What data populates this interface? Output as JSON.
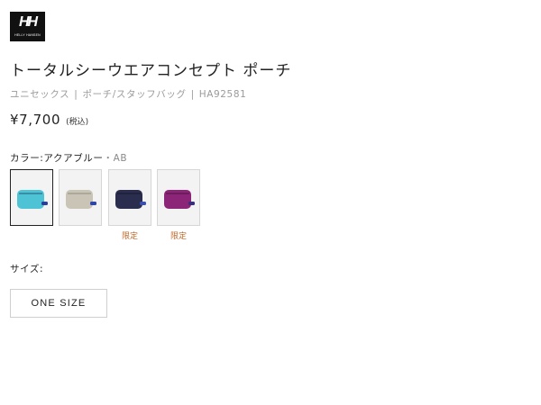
{
  "brand": {
    "logo_text": "HH",
    "logo_subtext": "HELLY HANSEN"
  },
  "product": {
    "title": "トータルシーウエアコンセプト ポーチ",
    "breadcrumb": [
      "ユニセックス",
      "ポーチ/スタッフバッグ",
      "HA92581"
    ],
    "breadcrumb_separator": "|",
    "price": "¥7,700",
    "tax_note": "(税込)"
  },
  "color": {
    "label": "カラー:アクアブルー",
    "code": "・AB",
    "swatches": [
      {
        "name": "aqua-blue",
        "body": "#4fc3d6",
        "zip": "#2a6f86",
        "tab": "#2a3f9a",
        "selected": true,
        "tag": ""
      },
      {
        "name": "beige",
        "body": "#c9c4b6",
        "zip": "#9b978a",
        "tab": "#3046a8",
        "selected": false,
        "tag": ""
      },
      {
        "name": "navy",
        "body": "#2b2d4f",
        "zip": "#1c1d34",
        "tab": "#3a4fb0",
        "selected": false,
        "tag": "限定"
      },
      {
        "name": "purple",
        "body": "#8c2478",
        "zip": "#5e1650",
        "tab": "#3a2f7a",
        "selected": false,
        "tag": "限定"
      }
    ]
  },
  "size": {
    "label": "サイズ:",
    "options": [
      "ONE SIZE"
    ]
  },
  "colors": {
    "limited_tag": "#c0692b",
    "selected_border": "#222222"
  }
}
